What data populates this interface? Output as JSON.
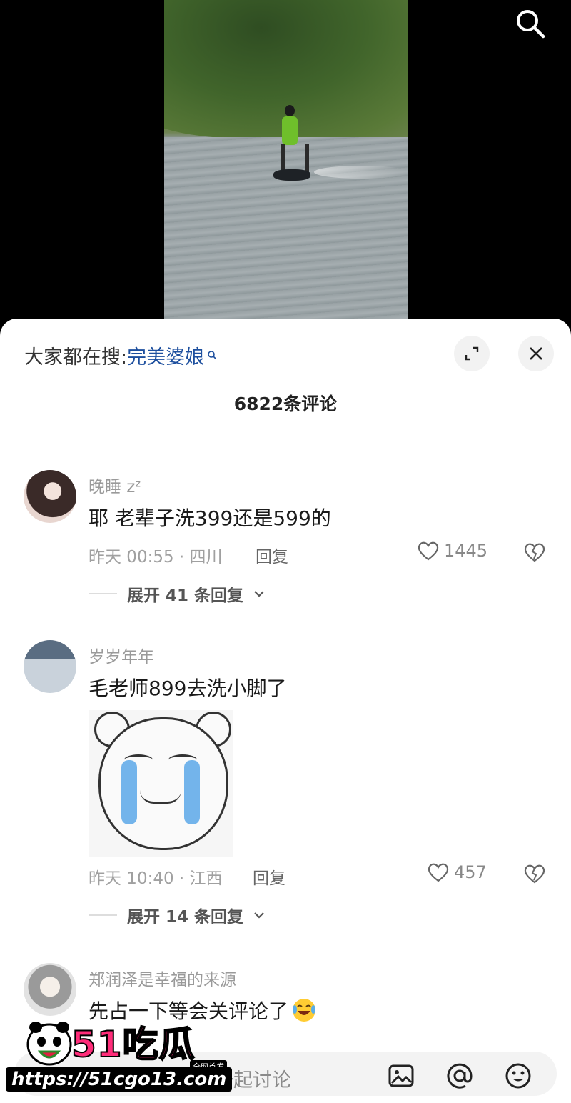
{
  "video": {
    "search_icon": "search-icon"
  },
  "sheet": {
    "hot_search_prefix": "大家都在搜:",
    "hot_search_term": "完美婆娘",
    "comment_count_title": "6822条评论",
    "expand_icon": "expand-icon",
    "close_icon": "close-icon"
  },
  "comments": [
    {
      "username": "晚睡 zᶻ",
      "text": "耶 老辈子洗399还是599的",
      "meta": "昨天 00:55 · 四川",
      "reply_label": "回复",
      "likes": "1445",
      "expand_label": "展开 41 条回复"
    },
    {
      "username": "岁岁年年",
      "text": "毛老师899去洗小脚了",
      "sticker": "crying-bear-sticker",
      "meta": "昨天 10:40 · 江西",
      "reply_label": "回复",
      "likes": "457",
      "expand_label": "展开 14 条回复"
    },
    {
      "username": "郑润泽是幸福的来源",
      "text": "先占一下等会关评论了",
      "emoji": "laughing-tears-emoji"
    }
  ],
  "input_bar": {
    "placeholder": "一起讨论",
    "icons": [
      "image-icon",
      "at-icon",
      "emoji-icon"
    ]
  },
  "watermark": {
    "logo_text": "51吃瓜",
    "badge": "全网首发",
    "url": "https://51cgo13.com"
  },
  "colors": {
    "link_blue": "#1d4f9e",
    "watermark_pink": "#ff2d7a"
  }
}
